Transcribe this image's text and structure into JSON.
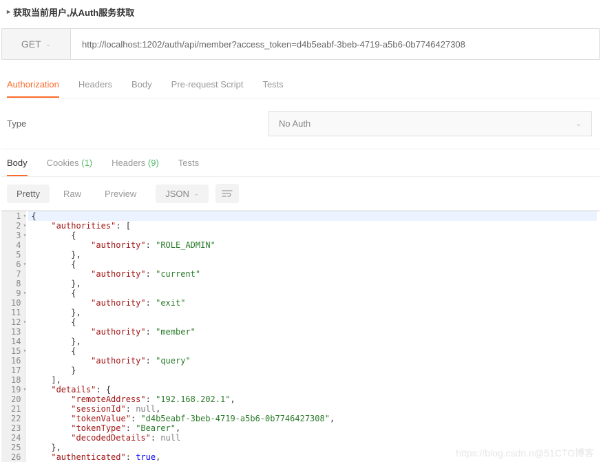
{
  "title": "获取当前用户,从Auth服务获取",
  "request": {
    "method": "GET",
    "url": "http://localhost:1202/auth/api/member?access_token=d4b5eabf-3beb-4719-a5b6-0b7746427308"
  },
  "reqTabs": {
    "authorization": "Authorization",
    "headers": "Headers",
    "body": "Body",
    "prerequest": "Pre-request Script",
    "tests": "Tests"
  },
  "auth": {
    "typeLabel": "Type",
    "selected": "No Auth"
  },
  "respTabs": {
    "body": "Body",
    "cookies": "Cookies",
    "cookiesCount": "(1)",
    "headers": "Headers",
    "headersCount": "(9)",
    "tests": "Tests"
  },
  "toolbar": {
    "pretty": "Pretty",
    "raw": "Raw",
    "preview": "Preview",
    "format": "JSON"
  },
  "code": [
    {
      "n": "1",
      "fold": true,
      "indent": 0,
      "parts": [
        {
          "t": "{",
          "c": "p"
        }
      ],
      "hl": true
    },
    {
      "n": "2",
      "fold": true,
      "indent": 1,
      "parts": [
        {
          "t": "\"authorities\"",
          "c": "k"
        },
        {
          "t": ": [",
          "c": "p"
        }
      ]
    },
    {
      "n": "3",
      "fold": true,
      "indent": 2,
      "parts": [
        {
          "t": "{",
          "c": "p"
        }
      ]
    },
    {
      "n": "4",
      "fold": false,
      "indent": 3,
      "parts": [
        {
          "t": "\"authority\"",
          "c": "k"
        },
        {
          "t": ": ",
          "c": "p"
        },
        {
          "t": "\"ROLE_ADMIN\"",
          "c": "s"
        }
      ]
    },
    {
      "n": "5",
      "fold": false,
      "indent": 2,
      "parts": [
        {
          "t": "},",
          "c": "p"
        }
      ]
    },
    {
      "n": "6",
      "fold": true,
      "indent": 2,
      "parts": [
        {
          "t": "{",
          "c": "p"
        }
      ]
    },
    {
      "n": "7",
      "fold": false,
      "indent": 3,
      "parts": [
        {
          "t": "\"authority\"",
          "c": "k"
        },
        {
          "t": ": ",
          "c": "p"
        },
        {
          "t": "\"current\"",
          "c": "s"
        }
      ]
    },
    {
      "n": "8",
      "fold": false,
      "indent": 2,
      "parts": [
        {
          "t": "},",
          "c": "p"
        }
      ]
    },
    {
      "n": "9",
      "fold": true,
      "indent": 2,
      "parts": [
        {
          "t": "{",
          "c": "p"
        }
      ]
    },
    {
      "n": "10",
      "fold": false,
      "indent": 3,
      "parts": [
        {
          "t": "\"authority\"",
          "c": "k"
        },
        {
          "t": ": ",
          "c": "p"
        },
        {
          "t": "\"exit\"",
          "c": "s"
        }
      ]
    },
    {
      "n": "11",
      "fold": false,
      "indent": 2,
      "parts": [
        {
          "t": "},",
          "c": "p"
        }
      ]
    },
    {
      "n": "12",
      "fold": true,
      "indent": 2,
      "parts": [
        {
          "t": "{",
          "c": "p"
        }
      ]
    },
    {
      "n": "13",
      "fold": false,
      "indent": 3,
      "parts": [
        {
          "t": "\"authority\"",
          "c": "k"
        },
        {
          "t": ": ",
          "c": "p"
        },
        {
          "t": "\"member\"",
          "c": "s"
        }
      ]
    },
    {
      "n": "14",
      "fold": false,
      "indent": 2,
      "parts": [
        {
          "t": "},",
          "c": "p"
        }
      ]
    },
    {
      "n": "15",
      "fold": true,
      "indent": 2,
      "parts": [
        {
          "t": "{",
          "c": "p"
        }
      ]
    },
    {
      "n": "16",
      "fold": false,
      "indent": 3,
      "parts": [
        {
          "t": "\"authority\"",
          "c": "k"
        },
        {
          "t": ": ",
          "c": "p"
        },
        {
          "t": "\"query\"",
          "c": "s"
        }
      ]
    },
    {
      "n": "17",
      "fold": false,
      "indent": 2,
      "parts": [
        {
          "t": "}",
          "c": "p"
        }
      ]
    },
    {
      "n": "18",
      "fold": false,
      "indent": 1,
      "parts": [
        {
          "t": "],",
          "c": "p"
        }
      ]
    },
    {
      "n": "19",
      "fold": true,
      "indent": 1,
      "parts": [
        {
          "t": "\"details\"",
          "c": "k"
        },
        {
          "t": ": {",
          "c": "p"
        }
      ]
    },
    {
      "n": "20",
      "fold": false,
      "indent": 2,
      "parts": [
        {
          "t": "\"remoteAddress\"",
          "c": "k"
        },
        {
          "t": ": ",
          "c": "p"
        },
        {
          "t": "\"192.168.202.1\"",
          "c": "s"
        },
        {
          "t": ",",
          "c": "p"
        }
      ]
    },
    {
      "n": "21",
      "fold": false,
      "indent": 2,
      "parts": [
        {
          "t": "\"sessionId\"",
          "c": "k"
        },
        {
          "t": ": ",
          "c": "p"
        },
        {
          "t": "null",
          "c": "n"
        },
        {
          "t": ",",
          "c": "p"
        }
      ]
    },
    {
      "n": "22",
      "fold": false,
      "indent": 2,
      "parts": [
        {
          "t": "\"tokenValue\"",
          "c": "k"
        },
        {
          "t": ": ",
          "c": "p"
        },
        {
          "t": "\"d4b5eabf-3beb-4719-a5b6-0b7746427308\"",
          "c": "s"
        },
        {
          "t": ",",
          "c": "p"
        }
      ]
    },
    {
      "n": "23",
      "fold": false,
      "indent": 2,
      "parts": [
        {
          "t": "\"tokenType\"",
          "c": "k"
        },
        {
          "t": ": ",
          "c": "p"
        },
        {
          "t": "\"Bearer\"",
          "c": "s"
        },
        {
          "t": ",",
          "c": "p"
        }
      ]
    },
    {
      "n": "24",
      "fold": false,
      "indent": 2,
      "parts": [
        {
          "t": "\"decodedDetails\"",
          "c": "k"
        },
        {
          "t": ": ",
          "c": "p"
        },
        {
          "t": "null",
          "c": "n"
        }
      ]
    },
    {
      "n": "25",
      "fold": false,
      "indent": 1,
      "parts": [
        {
          "t": "},",
          "c": "p"
        }
      ]
    },
    {
      "n": "26",
      "fold": false,
      "indent": 1,
      "parts": [
        {
          "t": "\"authenticated\"",
          "c": "k"
        },
        {
          "t": ": ",
          "c": "p"
        },
        {
          "t": "true",
          "c": "b"
        },
        {
          "t": ",",
          "c": "p"
        }
      ]
    }
  ],
  "watermark": "https://blog.csdn.n@51CTO博客"
}
